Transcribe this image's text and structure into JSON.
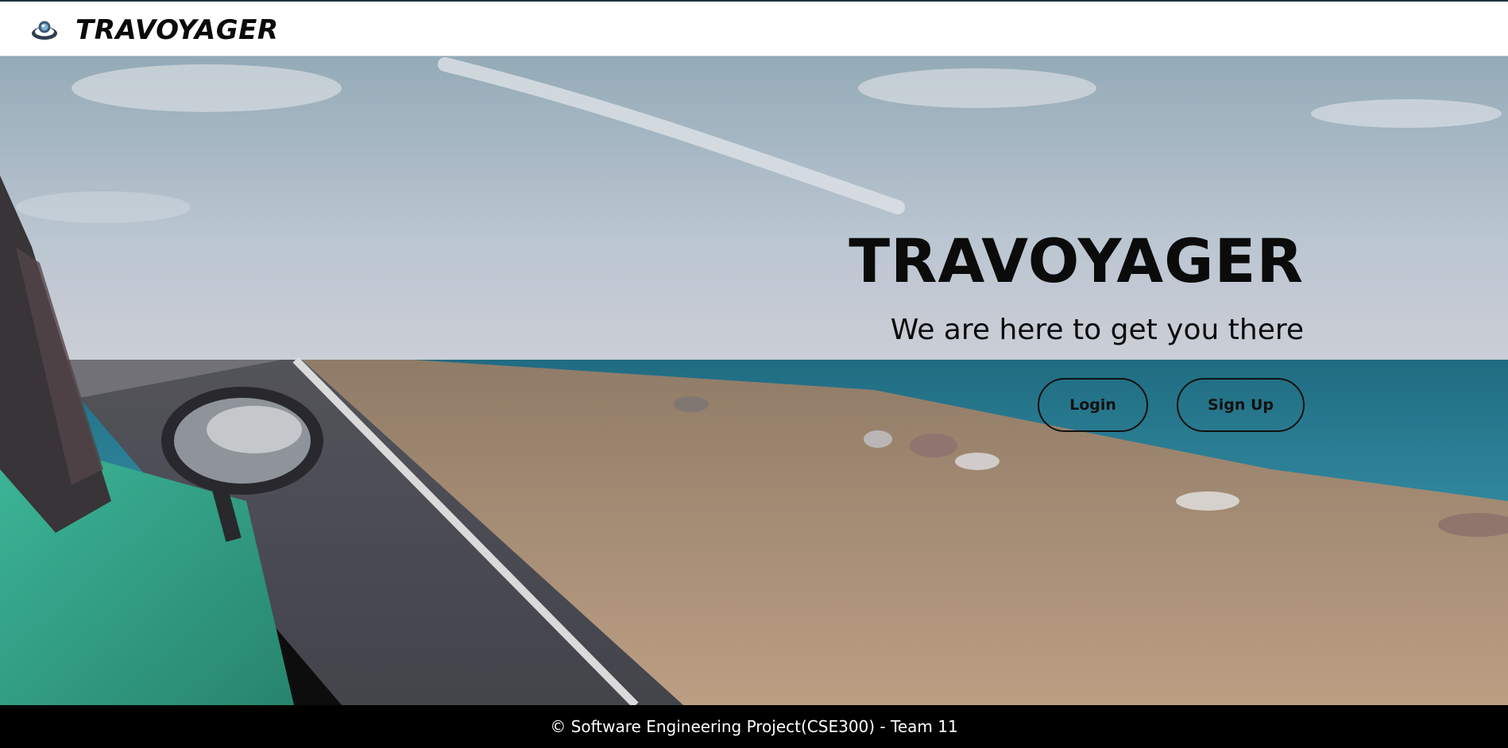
{
  "header": {
    "logo_icon": "globe-eye-icon",
    "brand_name": "TRAVOYAGER"
  },
  "hero": {
    "title": "TRAVOYAGER",
    "subtitle": "We are here to get you there",
    "background_image": "coastal-road-with-car-mirror",
    "buttons": {
      "login_label": "Login",
      "signup_label": "Sign Up"
    }
  },
  "footer": {
    "text": "© Software Engineering Project(CSE300) - Team 11"
  },
  "colors": {
    "header_bg": "#ffffff",
    "footer_bg": "#000000",
    "text_dark": "#0b0b0b",
    "sea": "#1f7f95",
    "sand": "#b89a78",
    "car": "#2aa386"
  }
}
